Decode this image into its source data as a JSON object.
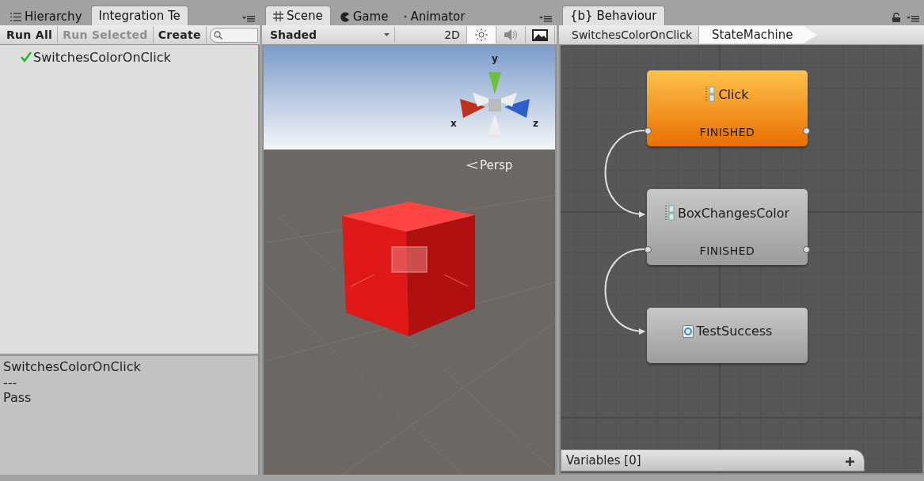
{
  "hierarchy_panel": {
    "tabs": [
      {
        "label": "Hierarchy",
        "selected": false
      },
      {
        "label": "Integration Te",
        "selected": true
      }
    ],
    "toolbar": [
      {
        "label": "Run All",
        "disabled": false
      },
      {
        "label": "Run Selected",
        "disabled": true
      },
      {
        "label": "Create",
        "disabled": false
      }
    ],
    "tests": [
      {
        "name": "SwitchesColorOnClick",
        "passed": true
      }
    ],
    "details": [
      "SwitchesColorOnClick",
      "---",
      "Pass"
    ]
  },
  "scene_panel": {
    "tabs": [
      {
        "label": "Scene",
        "selected": true
      },
      {
        "label": "Game",
        "selected": false
      },
      {
        "label": "Animator",
        "selected": false
      }
    ],
    "shading": "Shaded",
    "toolbar": [
      {
        "kind": "text",
        "label": "2D",
        "on": false
      },
      {
        "kind": "light",
        "on": true
      },
      {
        "kind": "audio",
        "on": false
      },
      {
        "kind": "image",
        "on": false
      }
    ],
    "gizmo_axes": [
      "y",
      "x",
      "z"
    ],
    "projection": "Persp"
  },
  "behaviour_panel": {
    "tab": {
      "label": "{b} Behaviour",
      "selected": true
    },
    "breadcrumbs": [
      {
        "label": "SwitchesColorOnClick",
        "selected": false
      },
      {
        "label": "StateMachine",
        "selected": true
      }
    ],
    "nodes": [
      {
        "title": "Click",
        "kind": "state",
        "start": true,
        "event": "FINISHED"
      },
      {
        "title": "BoxChangesColor",
        "kind": "state",
        "start": false,
        "event": "FINISHED"
      },
      {
        "title": "TestSuccess",
        "kind": "script",
        "start": false
      }
    ],
    "variables": "Variables [0]"
  }
}
